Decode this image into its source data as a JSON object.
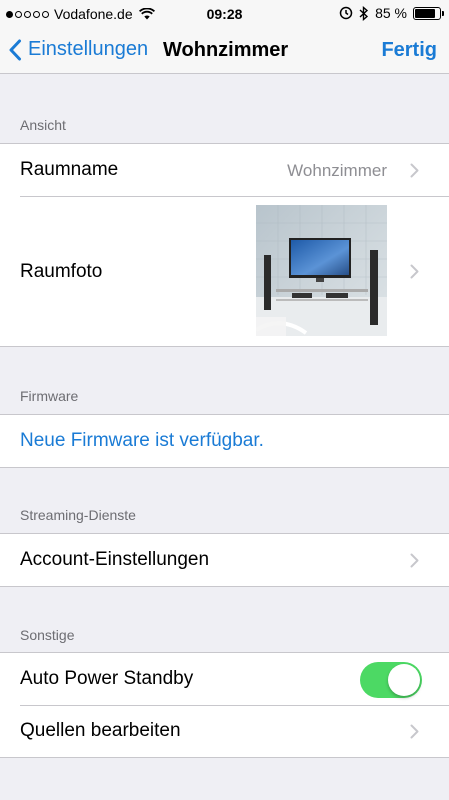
{
  "status_bar": {
    "carrier": "Vodafone.de",
    "signal_bars_filled": 1,
    "signal_bars_total": 5,
    "time": "09:28",
    "battery_percent_text": "85 %",
    "battery_level": 0.85
  },
  "navbar": {
    "back_label": "Einstellungen",
    "title": "Wohnzimmer",
    "done_label": "Fertig"
  },
  "sections": {
    "ansicht": {
      "header": "Ansicht",
      "raumname_label": "Raumname",
      "raumname_value": "Wohnzimmer",
      "raumfoto_label": "Raumfoto"
    },
    "firmware": {
      "header": "Firmware",
      "link_label": "Neue Firmware ist verfügbar."
    },
    "streaming": {
      "header": "Streaming-Dienste",
      "account_label": "Account-Einstellungen"
    },
    "sonstige": {
      "header": "Sonstige",
      "standby_label": "Auto Power Standby",
      "standby_on": true,
      "sources_label": "Quellen bearbeiten"
    }
  },
  "colors": {
    "accent": "#1a7bd5",
    "toggle_on": "#4cd964",
    "background": "#efeff4"
  },
  "icons": [
    "wifi-icon",
    "alarm-icon",
    "bluetooth-icon",
    "battery-icon",
    "back-chevron-icon",
    "chevron-right-icon"
  ]
}
